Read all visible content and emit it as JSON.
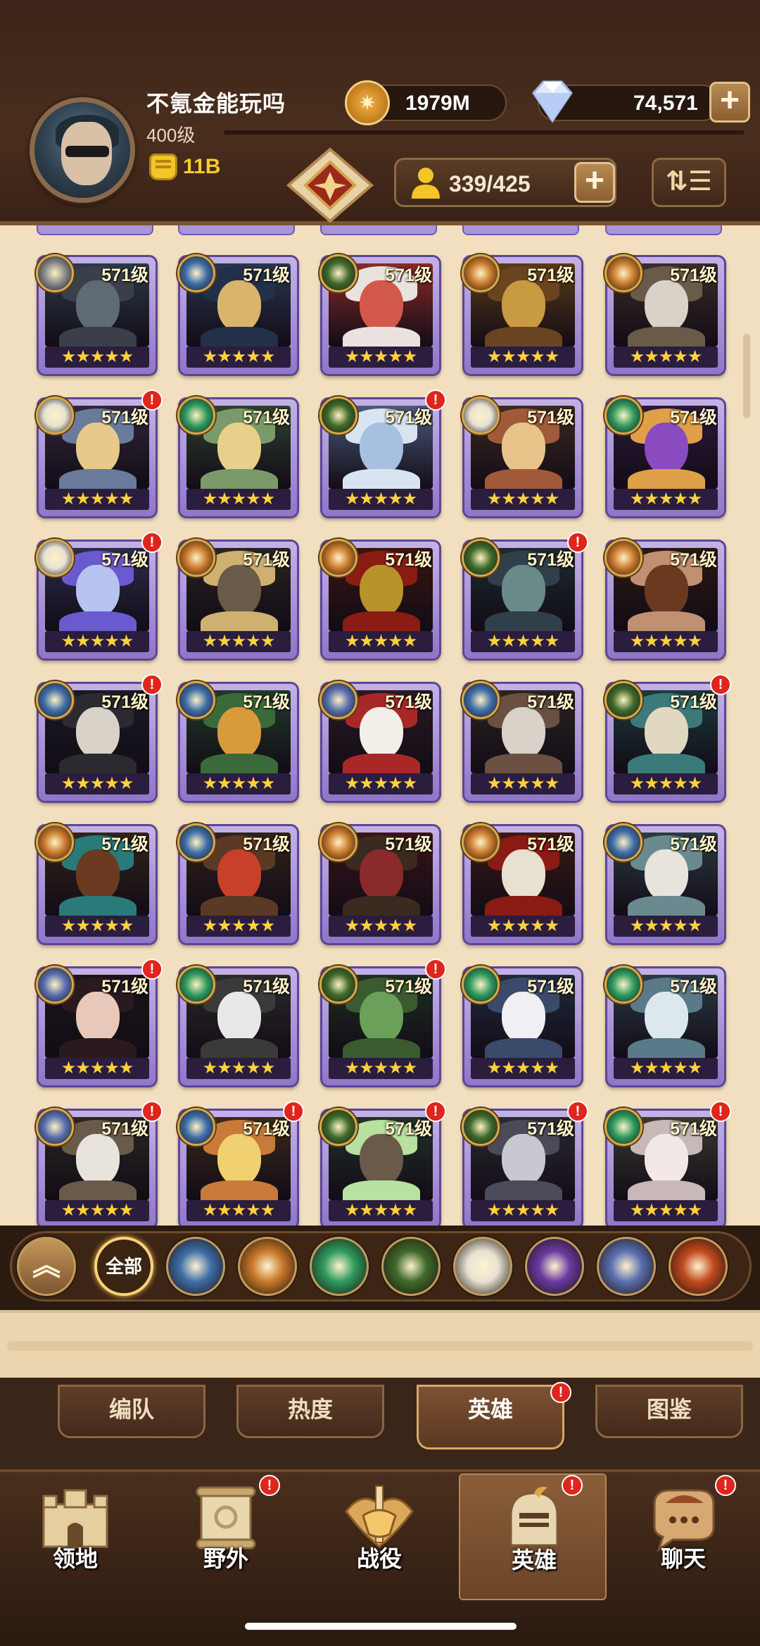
{
  "header": {
    "player_name": "不氪金能玩吗",
    "player_level": "400级",
    "power": "11B",
    "gold": "1979M",
    "diamonds": "74,571",
    "hero_count": "339/425"
  },
  "heroes": [
    {
      "level": "571级",
      "faction": "forest",
      "stars": "★★★★★",
      "alert": false
    },
    {
      "level": "571级",
      "faction": "lightbearer",
      "stars": "★★★★★",
      "alert": false
    },
    {
      "level": "571级",
      "faction": "graveborn",
      "stars": "★★★★★",
      "alert": false
    },
    {
      "level": "571级",
      "faction": "mauler",
      "stars": "★★★★★",
      "alert": false
    },
    {
      "level": "571级",
      "faction": "mauler",
      "stars": "★★★★★",
      "alert": false
    },
    {
      "level": "571级",
      "faction": "celestial",
      "stars": "★★★★★",
      "alert": true
    },
    {
      "level": "571级",
      "faction": "wilder",
      "stars": "★★★★★",
      "alert": false
    },
    {
      "level": "571级",
      "faction": "graveborn",
      "stars": "★★★★★",
      "alert": true
    },
    {
      "level": "571级",
      "faction": "celestial",
      "stars": "★★★★★",
      "alert": false
    },
    {
      "level": "571级",
      "faction": "wilder",
      "stars": "★★★★★",
      "alert": false
    },
    {
      "level": "571级",
      "faction": "celestial-wilder",
      "stars": "★★★★★",
      "alert": true
    },
    {
      "level": "571级",
      "faction": "mauler",
      "stars": "★★★★★",
      "alert": false
    },
    {
      "level": "571级",
      "faction": "mauler",
      "stars": "★★★★★",
      "alert": false
    },
    {
      "level": "571级",
      "faction": "graveborn",
      "stars": "★★★★★",
      "alert": true
    },
    {
      "level": "571级",
      "faction": "mauler",
      "stars": "★★★★★",
      "alert": false
    },
    {
      "level": "571级",
      "faction": "lightbearer",
      "stars": "★★★★★",
      "alert": true
    },
    {
      "level": "571级",
      "faction": "lightbearer",
      "stars": "★★★★★",
      "alert": false
    },
    {
      "level": "571级",
      "faction": "dimensional",
      "stars": "★★★★★",
      "alert": false
    },
    {
      "level": "571级",
      "faction": "lightbearer",
      "stars": "★★★★★",
      "alert": false
    },
    {
      "level": "571级",
      "faction": "graveborn",
      "stars": "★★★★★",
      "alert": true
    },
    {
      "level": "571级",
      "faction": "mauler",
      "stars": "★★★★★",
      "alert": false
    },
    {
      "level": "571级",
      "faction": "lightbearer",
      "stars": "★★★★★",
      "alert": false
    },
    {
      "level": "571级",
      "faction": "mauler",
      "stars": "★★★★★",
      "alert": false
    },
    {
      "level": "571级",
      "faction": "mauler",
      "stars": "★★★★★",
      "alert": false
    },
    {
      "level": "571级",
      "faction": "lightbearer",
      "stars": "★★★★★",
      "alert": false
    },
    {
      "level": "571级",
      "faction": "dimensional",
      "stars": "★★★★★",
      "alert": true
    },
    {
      "level": "571级",
      "faction": "wilder",
      "stars": "★★★★★",
      "alert": false
    },
    {
      "level": "571级",
      "faction": "graveborn",
      "stars": "★★★★★",
      "alert": true
    },
    {
      "level": "571级",
      "faction": "wilder",
      "stars": "★★★★★",
      "alert": false
    },
    {
      "level": "571级",
      "faction": "wilder",
      "stars": "★★★★★",
      "alert": false
    },
    {
      "level": "571级",
      "faction": "dimensional",
      "stars": "★★★★★",
      "alert": true
    },
    {
      "level": "571级",
      "faction": "lightbearer",
      "stars": "★★★★★",
      "alert": true
    },
    {
      "level": "571级",
      "faction": "graveborn",
      "stars": "★★★★★",
      "alert": true
    },
    {
      "level": "571级",
      "faction": "graveborn",
      "stars": "★★★★★",
      "alert": true
    },
    {
      "level": "571级",
      "faction": "wilder",
      "stars": "★★★★★",
      "alert": true
    }
  ],
  "filters": {
    "all_label": "全部",
    "items": [
      "lightbearer",
      "mauler",
      "wilder",
      "graveborn",
      "celestial",
      "hypogean",
      "dimensional",
      "dragon"
    ]
  },
  "subtabs": [
    {
      "label": "编队",
      "active": false,
      "alert": false
    },
    {
      "label": "热度",
      "active": false,
      "alert": false
    },
    {
      "label": "英雄",
      "active": true,
      "alert": true
    },
    {
      "label": "图鉴",
      "active": false,
      "alert": false
    }
  ],
  "nav": [
    {
      "label": "领地",
      "icon": "castle-icon",
      "alert": false,
      "active": false
    },
    {
      "label": "野外",
      "icon": "scroll-map-icon",
      "alert": true,
      "active": false
    },
    {
      "label": "战役",
      "icon": "sword-crest-icon",
      "alert": false,
      "active": false
    },
    {
      "label": "英雄",
      "icon": "helmet-icon",
      "alert": true,
      "active": true
    },
    {
      "label": "聊天",
      "icon": "chat-bubble-icon",
      "alert": true,
      "active": false
    }
  ],
  "colors": {
    "lightbearer": "#3f6ea8",
    "mauler": "#c9782a",
    "wilder": "#2f9a5e",
    "graveborn": "#3f6a2a",
    "celestial": "#e8e2d2",
    "hypogean": "#6a3aa0",
    "dimensional": "#5a6fb0",
    "dragon": "#c24a1e"
  }
}
